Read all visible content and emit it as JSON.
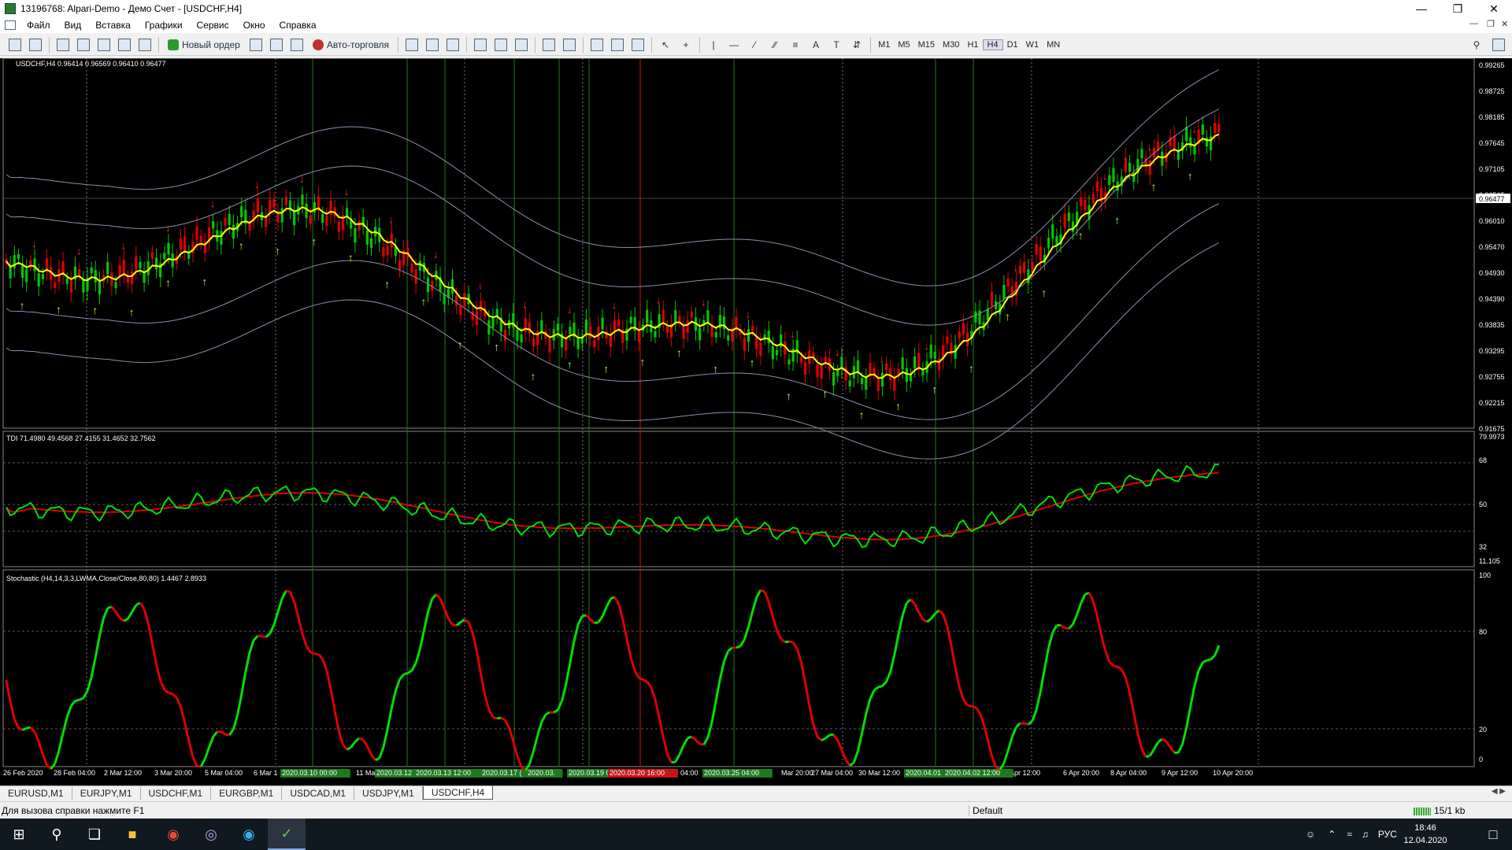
{
  "window": {
    "title": "13196768: Alpari-Demo - Демо Счет - [USDCHF,H4]"
  },
  "menu": [
    "Файл",
    "Вид",
    "Вставка",
    "Графики",
    "Сервис",
    "Окно",
    "Справка"
  ],
  "toolbar": {
    "new_order": "Новый ордер",
    "auto_trading": "Авто-торговля",
    "timeframes": [
      "M1",
      "M5",
      "M15",
      "M30",
      "H1",
      "H4",
      "D1",
      "W1",
      "MN"
    ],
    "active_timeframe": "H4"
  },
  "chart": {
    "main_label": "USDCHF,H4  0.96414 0.96569 0.96410 0.96477",
    "current_price": "0.96477",
    "price_axis": [
      "0.99265",
      "0.98725",
      "0.98185",
      "0.97645",
      "0.97105",
      "0.96565",
      "0.96010",
      "0.95470",
      "0.94930",
      "0.94390",
      "0.93835",
      "0.93295",
      "0.92755",
      "0.92215",
      "0.91675"
    ],
    "tdi_label": "TDI 71.4980 49.4568 27.4155 31.4652 32.7562",
    "tdi_axis": [
      "79.9973",
      "68",
      "50",
      "32",
      "11.105"
    ],
    "stoch_label": "Stochastic (H4,14,3,3,LWMA,Close/Close,80,80) 1.4467 2.8933",
    "stoch_axis": [
      "100",
      "80",
      "20",
      "0"
    ],
    "time_axis": [
      "26 Feb 2020",
      "28 Feb 04:00",
      "2 Mar 12:00",
      "3 Mar 20:00",
      "5 Mar 04:00",
      "6 Mar 1",
      "11 Ma",
      "Mar 04:00",
      "Mar 20:00",
      "27 Mar 04:00",
      "30 Mar 12:00",
      "3 Apr 12:00",
      "6 Apr 20:00",
      "8 Apr 04:00",
      "9 Apr 12:00",
      "10 Apr 20:00"
    ],
    "highlighted_times": [
      {
        "text": "2020.03.10 00:00",
        "color": "#1e7a1e"
      },
      {
        "text": "2020.03.12 ",
        "color": "#1e7a1e"
      },
      {
        "text": "2020.03.13 12:00",
        "color": "#1e7a1e"
      },
      {
        "text": "2020.03.17 (",
        "color": "#1e7a1e"
      },
      {
        "text": "2020.03.",
        "color": "#1e7a1e"
      },
      {
        "text": "2020.03.19 08",
        "color": "#1e7a1e"
      },
      {
        "text": "2020.03.20 16:00",
        "color": "#c81414"
      },
      {
        "text": "2020.03.25 04:00",
        "color": "#1e7a1e"
      },
      {
        "text": "2020.04.01 ",
        "color": "#1e7a1e"
      },
      {
        "text": "2020.04.02 12:00",
        "color": "#1e7a1e"
      }
    ],
    "colors": {
      "bull": "#00c800",
      "bear": "#e00000",
      "ma": "#ffff00",
      "bands": "#8a90b0",
      "tdi_green": "#00e000",
      "tdi_red": "#e00000",
      "up_arrow": "#a0ff40",
      "down_arrow": "#ff2020"
    }
  },
  "tabs": [
    "EURUSD,M1",
    "EURJPY,M1",
    "USDCHF,M1",
    "EURGBP,M1",
    "USDCAD,M1",
    "USDJPY,M1",
    "USDCHF,H4"
  ],
  "active_tab": "USDCHF,H4",
  "status": {
    "help": "Для вызова справки нажмите F1",
    "profile": "Default",
    "traffic": "15/1 kb"
  },
  "taskbar": {
    "lang": "РУС",
    "time": "18:46",
    "date": "12.04.2020"
  }
}
